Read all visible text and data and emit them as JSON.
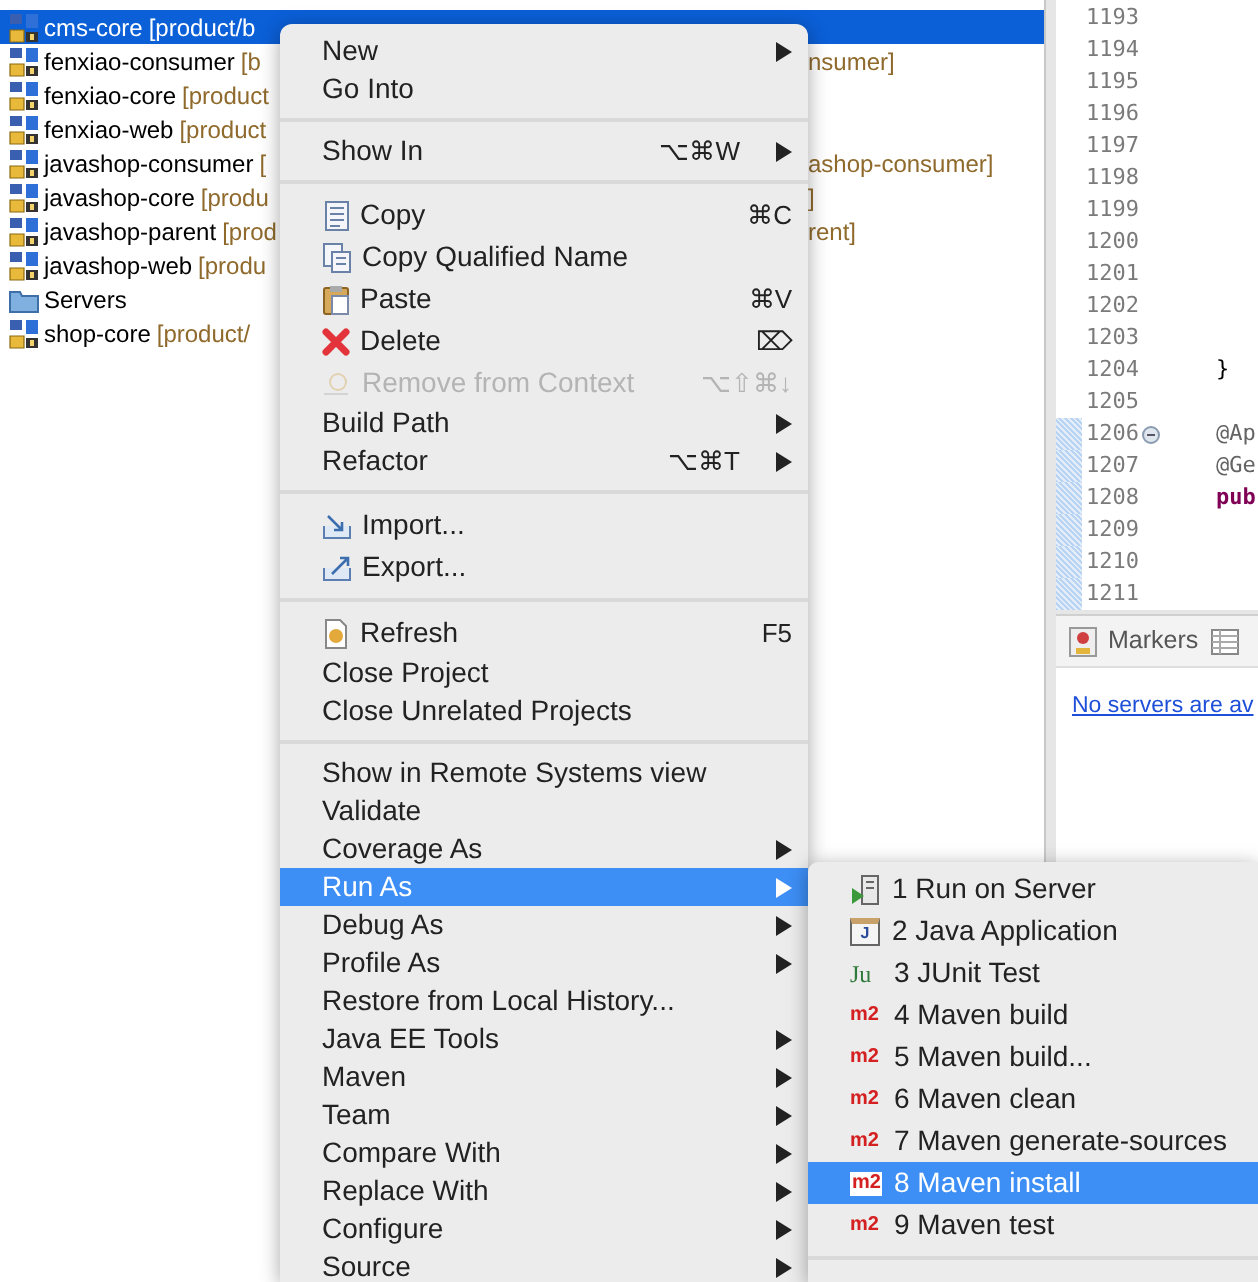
{
  "project_tree": [
    {
      "name": "cms-core",
      "detail": "[product/b",
      "selected": true,
      "kind": "project"
    },
    {
      "name": "fenxiao-consumer",
      "detail": "[b",
      "tail": "nsumer]",
      "selected": false,
      "kind": "project"
    },
    {
      "name": "fenxiao-core",
      "detail": "[product",
      "selected": false,
      "kind": "project"
    },
    {
      "name": "fenxiao-web",
      "detail": "[product",
      "selected": false,
      "kind": "project"
    },
    {
      "name": "javashop-consumer",
      "detail": "[",
      "tail": "ashop-consumer]",
      "selected": false,
      "kind": "project"
    },
    {
      "name": "javashop-core",
      "detail": "[produ",
      "tail": "]",
      "selected": false,
      "kind": "project"
    },
    {
      "name": "javashop-parent",
      "detail": "[prod",
      "tail": "rent]",
      "selected": false,
      "kind": "project"
    },
    {
      "name": "javashop-web",
      "detail": "[produ",
      "selected": false,
      "kind": "project"
    },
    {
      "name": "Servers",
      "selected": false,
      "kind": "folder"
    },
    {
      "name": "shop-core",
      "detail": "[product/",
      "selected": false,
      "kind": "project"
    }
  ],
  "editor": {
    "lines": [
      {
        "number": "1193",
        "collapsible": false,
        "changed": false
      },
      {
        "number": "1194",
        "collapsible": false,
        "changed": false
      },
      {
        "number": "1195",
        "collapsible": false,
        "changed": false
      },
      {
        "number": "1196",
        "collapsible": false,
        "changed": false
      },
      {
        "number": "1197",
        "collapsible": false,
        "changed": false
      },
      {
        "number": "1198",
        "collapsible": false,
        "changed": false
      },
      {
        "number": "1199",
        "collapsible": false,
        "changed": false
      },
      {
        "number": "1200",
        "collapsible": false,
        "changed": false
      },
      {
        "number": "1201",
        "collapsible": false,
        "changed": false
      },
      {
        "number": "1202",
        "collapsible": false,
        "changed": false
      },
      {
        "number": "1203",
        "collapsible": false,
        "changed": false
      },
      {
        "number": "1204",
        "code": "}",
        "kind": "plain",
        "collapsible": false,
        "changed": false
      },
      {
        "number": "1205",
        "collapsible": false,
        "changed": false
      },
      {
        "number": "1206",
        "code": "@Ap",
        "kind": "annotation",
        "collapsible": true,
        "changed": true
      },
      {
        "number": "1207",
        "code": "@Ge",
        "kind": "annotation",
        "collapsible": false,
        "changed": true
      },
      {
        "number": "1208",
        "code": "pub",
        "kind": "keyword",
        "collapsible": false,
        "changed": true
      },
      {
        "number": "1209",
        "collapsible": false,
        "changed": true
      },
      {
        "number": "1210",
        "collapsible": false,
        "changed": true
      },
      {
        "number": "1211",
        "collapsible": false,
        "changed": true
      }
    ]
  },
  "servers_panel": {
    "tabs": [
      {
        "label": "Markers",
        "kind": "markers"
      },
      {
        "kind": "table"
      }
    ],
    "link": "No servers are av"
  },
  "context_menu": [
    {
      "kind": "text",
      "label": "New",
      "submenu": true,
      "disabled": false,
      "selected": false
    },
    {
      "kind": "text",
      "label": "Go Into",
      "submenu": false,
      "disabled": false,
      "selected": false
    },
    {
      "kind": "separator"
    },
    {
      "kind": "text",
      "label": "Show In",
      "shortcut": "⌥⌘W",
      "submenu": true,
      "disabled": false,
      "selected": false
    },
    {
      "kind": "separator"
    },
    {
      "kind": "copy",
      "label": "Copy",
      "shortcut": "⌘C",
      "submenu": false,
      "disabled": false,
      "selected": false
    },
    {
      "kind": "qualified",
      "label": "Copy Qualified Name",
      "submenu": false,
      "disabled": false,
      "selected": false
    },
    {
      "kind": "paste",
      "label": "Paste",
      "shortcut": "⌘V",
      "submenu": false,
      "disabled": false,
      "selected": false
    },
    {
      "kind": "delete",
      "label": "Delete",
      "shortcut": "⌦",
      "submenu": false,
      "disabled": false,
      "selected": false
    },
    {
      "kind": "remove",
      "label": "Remove from Context",
      "shortcut": "⌥⇧⌘↓",
      "submenu": false,
      "disabled": true,
      "selected": false
    },
    {
      "kind": "text",
      "label": "Build Path",
      "submenu": true,
      "disabled": false,
      "selected": false
    },
    {
      "kind": "text",
      "label": "Refactor",
      "shortcut": "⌥⌘T",
      "submenu": true,
      "disabled": false,
      "selected": false
    },
    {
      "kind": "separator"
    },
    {
      "kind": "import",
      "label": "Import...",
      "submenu": false,
      "disabled": false,
      "selected": false
    },
    {
      "kind": "export",
      "label": "Export...",
      "submenu": false,
      "disabled": false,
      "selected": false
    },
    {
      "kind": "separator"
    },
    {
      "kind": "refresh",
      "label": "Refresh",
      "shortcut": "F5",
      "submenu": false,
      "disabled": false,
      "selected": false
    },
    {
      "kind": "text",
      "label": "Close Project",
      "submenu": false,
      "disabled": false,
      "selected": false
    },
    {
      "kind": "text",
      "label": "Close Unrelated Projects",
      "submenu": false,
      "disabled": false,
      "selected": false
    },
    {
      "kind": "separator"
    },
    {
      "kind": "text",
      "label": "Show in Remote Systems view",
      "submenu": false,
      "disabled": false,
      "selected": false
    },
    {
      "kind": "text",
      "label": "Validate",
      "submenu": false,
      "disabled": false,
      "selected": false
    },
    {
      "kind": "text",
      "label": "Coverage As",
      "submenu": true,
      "disabled": false,
      "selected": false
    },
    {
      "kind": "text",
      "label": "Run As",
      "submenu": true,
      "disabled": false,
      "selected": true
    },
    {
      "kind": "text",
      "label": "Debug As",
      "submenu": true,
      "disabled": false,
      "selected": false
    },
    {
      "kind": "text",
      "label": "Profile As",
      "submenu": true,
      "disabled": false,
      "selected": false
    },
    {
      "kind": "text",
      "label": "Restore from Local History...",
      "submenu": false,
      "disabled": false,
      "selected": false
    },
    {
      "kind": "text",
      "label": "Java EE Tools",
      "submenu": true,
      "disabled": false,
      "selected": false
    },
    {
      "kind": "text",
      "label": "Maven",
      "submenu": true,
      "disabled": false,
      "selected": false
    },
    {
      "kind": "text",
      "label": "Team",
      "submenu": true,
      "disabled": false,
      "selected": false
    },
    {
      "kind": "text",
      "label": "Compare With",
      "submenu": true,
      "disabled": false,
      "selected": false
    },
    {
      "kind": "text",
      "label": "Replace With",
      "submenu": true,
      "disabled": false,
      "selected": false
    },
    {
      "kind": "text",
      "label": "Configure",
      "submenu": true,
      "disabled": false,
      "selected": false
    },
    {
      "kind": "text",
      "label": "Source",
      "submenu": true,
      "disabled": false,
      "selected": false
    }
  ],
  "run_as_submenu": [
    {
      "kind": "server",
      "label": "1 Run on Server",
      "selected": false
    },
    {
      "kind": "java",
      "icon_text": "J",
      "label": "2 Java Application",
      "selected": false
    },
    {
      "kind": "junit",
      "icon_text": "Ju",
      "label": "3 JUnit Test",
      "selected": false
    },
    {
      "kind": "maven",
      "icon_text": "m2",
      "label": "4 Maven build",
      "selected": false
    },
    {
      "kind": "maven",
      "icon_text": "m2",
      "label": "5 Maven build...",
      "selected": false
    },
    {
      "kind": "maven",
      "icon_text": "m2",
      "label": "6 Maven clean",
      "selected": false
    },
    {
      "kind": "maven",
      "icon_text": "m2",
      "label": "7 Maven generate-sources",
      "selected": false
    },
    {
      "kind": "maven",
      "icon_text": "m2",
      "label": "8 Maven install",
      "selected": true
    },
    {
      "kind": "maven",
      "icon_text": "m2",
      "label": "9 Maven test",
      "selected": false
    }
  ]
}
